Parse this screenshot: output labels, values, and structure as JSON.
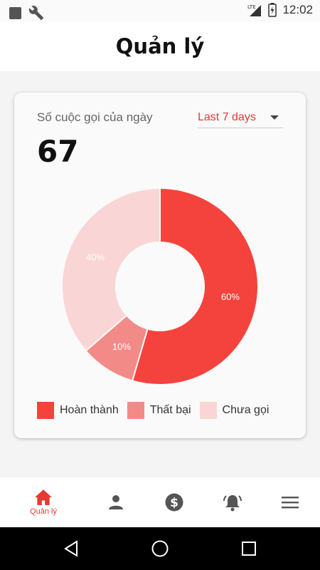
{
  "status_bar": {
    "time": "12:02",
    "network": "LTE",
    "icons": [
      "notification-square-icon",
      "wrench-icon",
      "signal-icon",
      "battery-icon"
    ]
  },
  "header": {
    "title": "Quản lý"
  },
  "card": {
    "label": "Số cuộc gọi của ngày",
    "range": "Last 7 days",
    "count": "67"
  },
  "chart_data": {
    "type": "pie",
    "donut": true,
    "slices": [
      {
        "name": "Hoàn thành",
        "value": 60,
        "label": "60%",
        "color": "#f4433c"
      },
      {
        "name": "Thất bại",
        "value": 10,
        "label": "10%",
        "color": "#f28b87"
      },
      {
        "name": "Chưa gọi",
        "value": 40,
        "label": "40%",
        "color": "#f9d6d5"
      }
    ]
  },
  "legend": [
    {
      "label": "Hoàn thành",
      "color": "#f4433c"
    },
    {
      "label": "Thất bại",
      "color": "#f28b87"
    },
    {
      "label": "Chưa gọi",
      "color": "#f9d6d5"
    }
  ],
  "bottom_nav": {
    "items": [
      {
        "icon": "home-icon",
        "label": "Quản lý",
        "active": true
      },
      {
        "icon": "person-icon",
        "label": "",
        "active": false
      },
      {
        "icon": "dollar-icon",
        "label": "",
        "active": false
      },
      {
        "icon": "alarm-bell-icon",
        "label": "",
        "active": false
      },
      {
        "icon": "menu-icon",
        "label": "",
        "active": false
      }
    ]
  },
  "colors": {
    "accent": "#e53935",
    "inactive_icon": "#555555"
  }
}
